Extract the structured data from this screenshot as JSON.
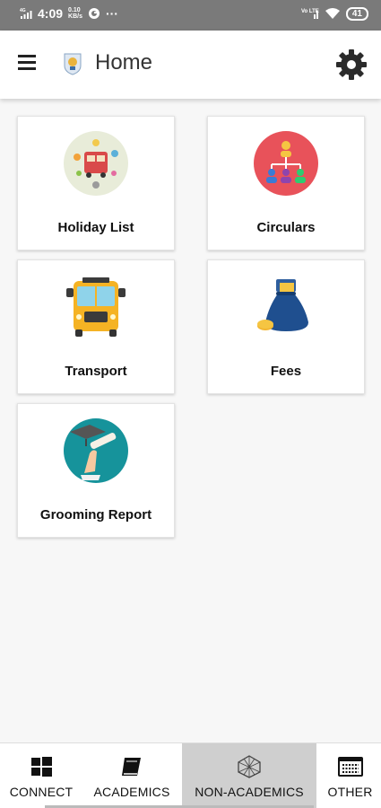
{
  "status": {
    "time": "4:09",
    "net_speed_top": "0.10",
    "net_speed_bottom": "KB/s",
    "signal_label": "4G",
    "volte_label": "Vo LTE",
    "battery": "41",
    "more": "···"
  },
  "appbar": {
    "title": "Home"
  },
  "tiles": [
    {
      "label": "Holiday List",
      "icon": "holiday-list-icon",
      "color": "#e8ecd9"
    },
    {
      "label": "Circulars",
      "icon": "circulars-icon",
      "color": "#e8525a"
    },
    {
      "label": "Transport",
      "icon": "school-bus-icon",
      "color": "#f5b324"
    },
    {
      "label": "Fees",
      "icon": "money-bag-icon",
      "color": "#1f4f8f"
    },
    {
      "label": "Grooming Report",
      "icon": "graduation-icon",
      "color": "#16939b"
    }
  ],
  "bottom_nav": [
    {
      "label": "CONNECT",
      "icon": "windows-icon",
      "active": false
    },
    {
      "label": "ACADEMICS",
      "icon": "book-icon",
      "active": false
    },
    {
      "label": "NON-ACADEMICS",
      "icon": "polyhedron-icon",
      "active": true
    },
    {
      "label": "OTHER",
      "icon": "keyboard-icon",
      "active": false
    }
  ]
}
